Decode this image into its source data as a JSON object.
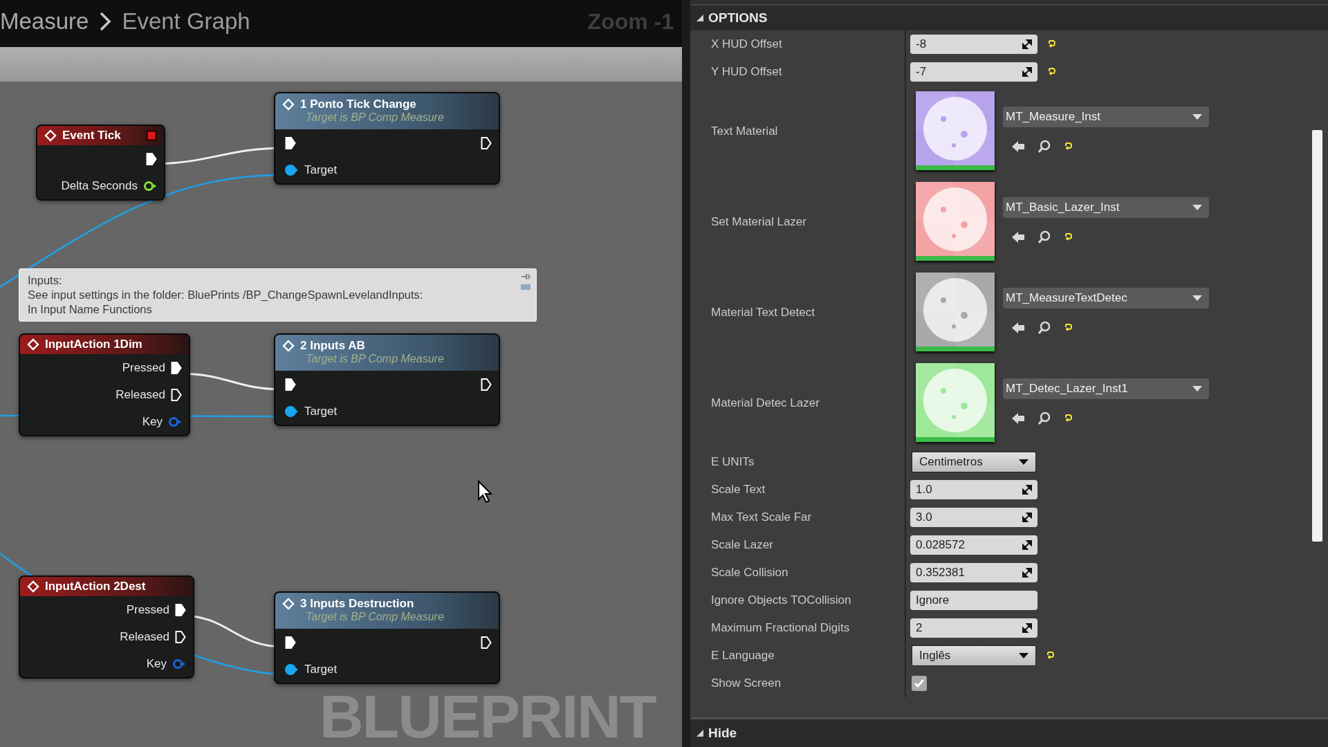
{
  "breadcrumb": {
    "parent": "Measure",
    "current": "Event Graph"
  },
  "zoom_label": "Zoom -1",
  "graph": {
    "nodes": [
      {
        "kind": "function",
        "title": "1 Ponto Tick  Change",
        "subtitle": "Target is BP Comp Measure",
        "pins": [
          {
            "kind": "exec",
            "connected": true
          },
          {
            "kind": "exec",
            "connected": false
          },
          {
            "kind": "object",
            "label": "Target",
            "connected": true
          }
        ]
      },
      {
        "kind": "event",
        "title": "Event Tick",
        "marker": true,
        "pins": [
          {
            "kind": "exec",
            "connected": true
          },
          {
            "kind": "float",
            "label": "Delta Seconds",
            "connected": false
          }
        ]
      },
      {
        "kind": "event",
        "title": "InputAction 1Dim",
        "marker": false,
        "pins": [
          {
            "kind": "exec",
            "label": "Pressed",
            "connected": true
          },
          {
            "kind": "exec",
            "label": "Released",
            "connected": false
          },
          {
            "kind": "key",
            "label": "Key",
            "connected": false
          }
        ]
      },
      {
        "kind": "function",
        "title": "2  Inputs AB",
        "subtitle": "Target is BP Comp Measure",
        "pins": [
          {
            "kind": "exec",
            "connected": true
          },
          {
            "kind": "exec",
            "connected": false
          },
          {
            "kind": "object",
            "label": "Target",
            "connected": true
          }
        ]
      },
      {
        "kind": "event",
        "title": "InputAction 2Dest",
        "marker": false,
        "pins": [
          {
            "kind": "exec",
            "label": "Pressed",
            "connected": true
          },
          {
            "kind": "exec",
            "label": "Released",
            "connected": false
          },
          {
            "kind": "key",
            "label": "Key",
            "connected": false
          }
        ]
      },
      {
        "kind": "function",
        "title": "3 Inputs Destruction",
        "subtitle": "Target is BP Comp Measure",
        "pins": [
          {
            "kind": "exec",
            "connected": true
          },
          {
            "kind": "exec",
            "connected": false
          },
          {
            "kind": "object",
            "label": "Target",
            "connected": true
          }
        ]
      }
    ],
    "comment": {
      "text": "Inputs:\nSee input settings in the folder: BluePrints /BP_ChangeSpawnLevelandInputs:\nIn Input Name Functions"
    },
    "watermark": "BLUEPRINT"
  },
  "details": {
    "section": "OPTIONS",
    "next_section": "Hide",
    "properties": [
      {
        "kind": "number",
        "label": "X HUD Offset",
        "value": "-8",
        "resettable": true
      },
      {
        "kind": "number",
        "label": "Y HUD Offset",
        "value": "-7",
        "resettable": true
      },
      {
        "kind": "asset",
        "label": "Text Material",
        "value": "MT_Measure_Inst",
        "color": "#b7a2ec",
        "resettable": true
      },
      {
        "kind": "asset",
        "label": "Set Material Lazer",
        "value": "MT_Basic_Lazer_Inst",
        "color": "#f3a3a3",
        "resettable": true
      },
      {
        "kind": "asset",
        "label": "Material Text Detect",
        "value": "MT_MeasureTextDetec",
        "color": "#a9a9a9",
        "resettable": true
      },
      {
        "kind": "asset",
        "label": "Material Detec Lazer",
        "value": "MT_Detec_Lazer_Inst1",
        "color": "#9ee89a",
        "resettable": true
      },
      {
        "kind": "enum",
        "label": "E UNITs",
        "value": "Centimetros",
        "resettable": false
      },
      {
        "kind": "number",
        "label": "Scale Text",
        "value": "1.0",
        "resettable": false
      },
      {
        "kind": "number",
        "label": "Max Text Scale Far",
        "value": "3.0",
        "resettable": false
      },
      {
        "kind": "number",
        "label": "Scale Lazer",
        "value": "0.028572",
        "resettable": false
      },
      {
        "kind": "number",
        "label": "Scale Collision",
        "value": "0.352381",
        "resettable": false
      },
      {
        "kind": "text",
        "label": "Ignore Objects TOCollision",
        "value": "Ignore",
        "resettable": false
      },
      {
        "kind": "number",
        "label": "Maximum Fractional Digits",
        "value": "2",
        "resettable": false
      },
      {
        "kind": "enum",
        "label": "E Language",
        "value": "Inglês",
        "resettable": true
      },
      {
        "kind": "checkbox",
        "label": "Show Screen",
        "checked": true
      }
    ]
  }
}
